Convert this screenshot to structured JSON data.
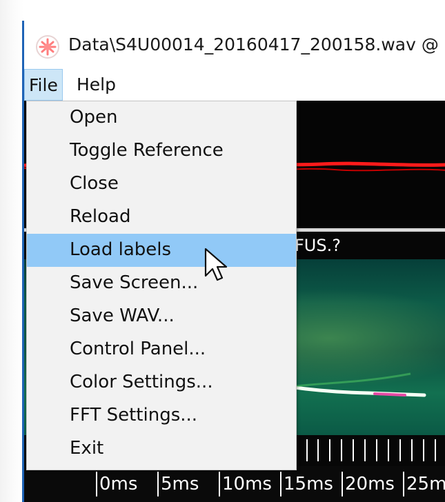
{
  "window": {
    "title": "Data\\S4U00014_20160417_200158.wav @"
  },
  "menubar": {
    "items": [
      "File",
      "Help"
    ]
  },
  "file_menu": {
    "items": [
      "Open",
      "Toggle Reference",
      "Close",
      "Reload",
      "Load labels",
      "Save Screen...",
      "Save WAV...",
      "Control Panel...",
      "Color Settings...",
      "FFT Settings...",
      "Exit"
    ],
    "highlighted": "Load labels"
  },
  "label_strip": {
    "text": "FUS.?"
  },
  "timeline": {
    "labels": [
      "0ms",
      "5ms",
      "10ms",
      "15ms",
      "20ms",
      "25m"
    ]
  },
  "colors": {
    "waveform_trace": "#ff1b1b",
    "menu_highlight": "#91c9f7",
    "spectrogram_green": "#0d5b48"
  }
}
